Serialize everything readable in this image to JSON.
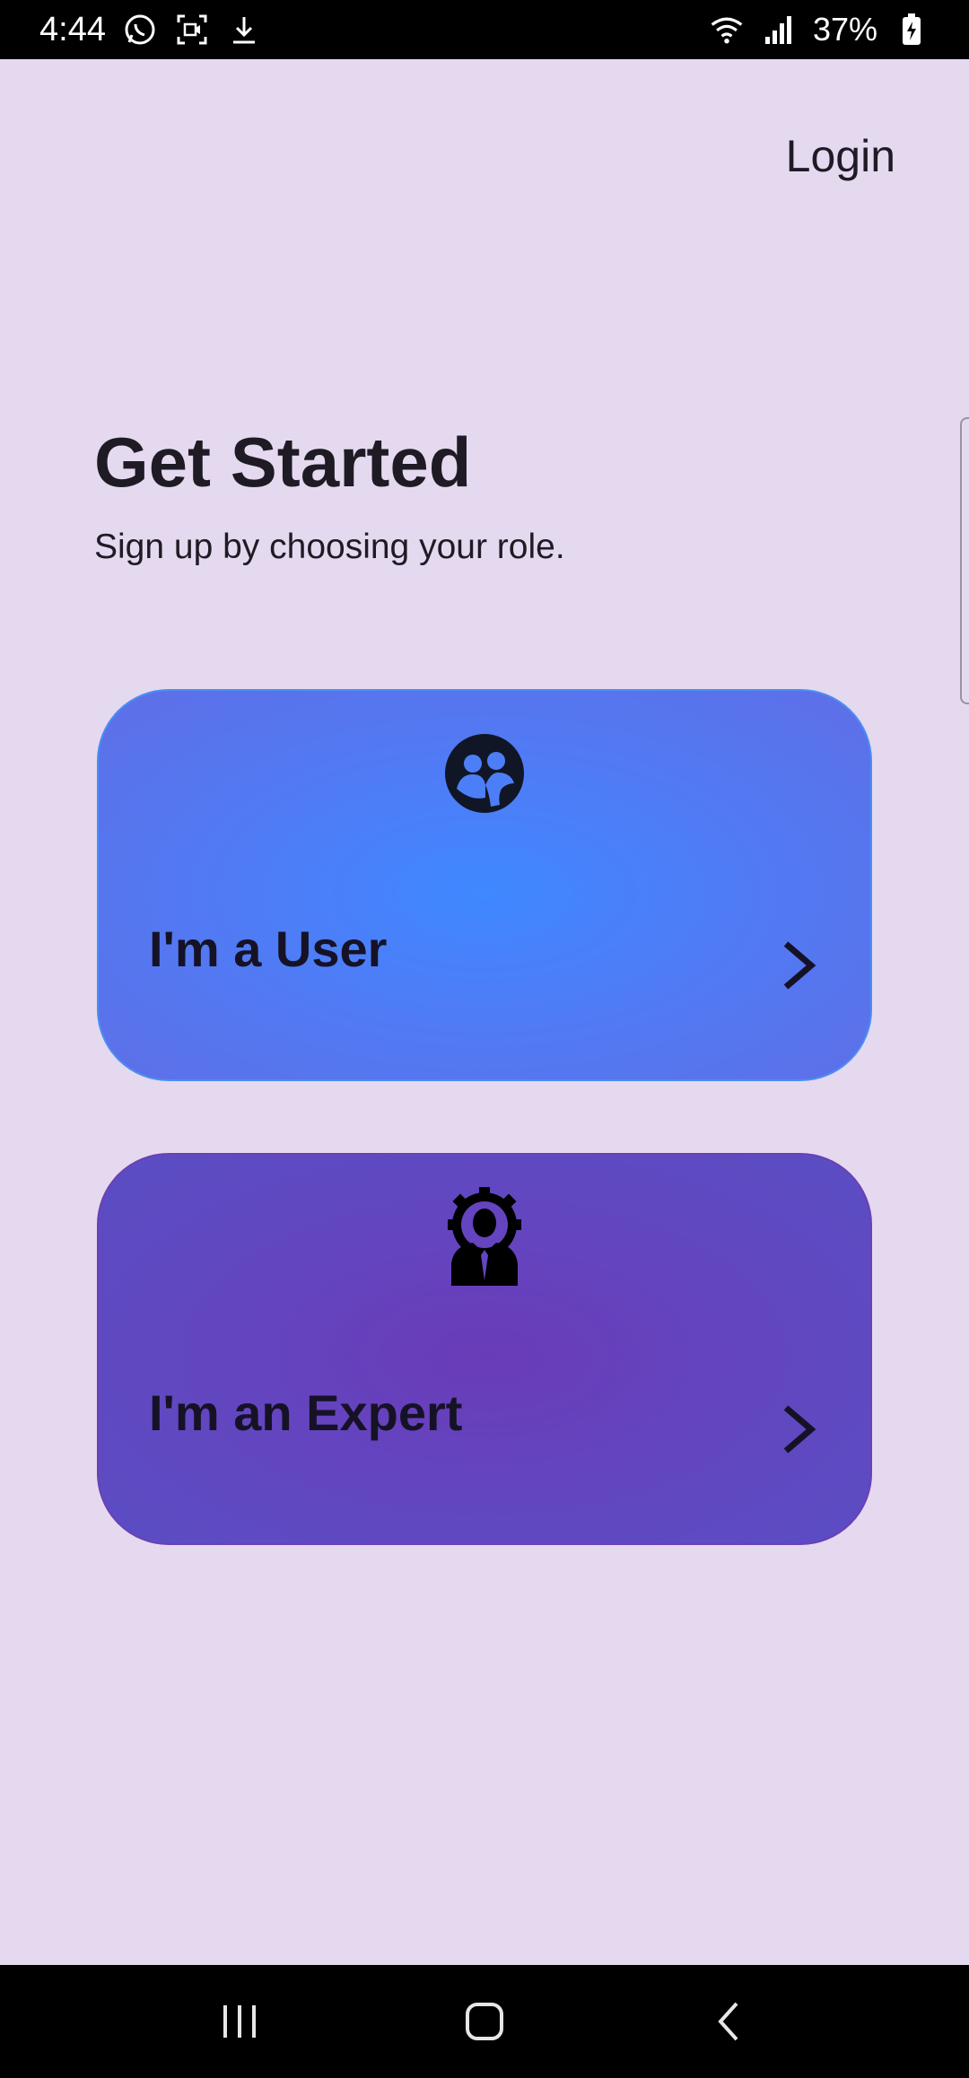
{
  "status_bar": {
    "time": "4:44",
    "battery_percent": "37%",
    "left_icons": [
      "whatsapp-icon",
      "screen-record-icon",
      "download-icon"
    ],
    "right_icons": [
      "wifi-icon",
      "signal-icon",
      "battery-charging-icon"
    ]
  },
  "header": {
    "login_label": "Login"
  },
  "intro": {
    "title": "Get Started",
    "subtitle": "Sign up by choosing your role."
  },
  "roles": [
    {
      "label": "I'm a User",
      "icon": "users-icon",
      "accent": "#3f88ff"
    },
    {
      "label": "I'm an Expert",
      "icon": "expert-gear-person-icon",
      "accent": "#6a3bb8"
    }
  ],
  "nav_bar": {
    "buttons": [
      "recent-apps-icon",
      "home-icon",
      "back-icon"
    ]
  },
  "colors": {
    "background": "#e5d9ef",
    "text": "#1f1b24"
  }
}
